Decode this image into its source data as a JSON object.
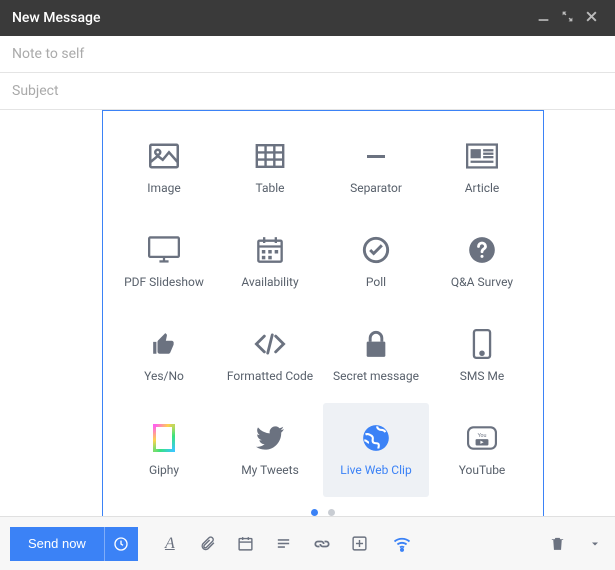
{
  "window": {
    "title": "New Message",
    "minimize_icon": "minimize",
    "expand_icon": "expand",
    "close_icon": "close"
  },
  "fields": {
    "to_placeholder": "Note to self",
    "subject_placeholder": "Subject"
  },
  "inserter": {
    "tiles": [
      {
        "label": "Image",
        "icon": "image"
      },
      {
        "label": "Table",
        "icon": "table"
      },
      {
        "label": "Separator",
        "icon": "separator"
      },
      {
        "label": "Article",
        "icon": "article"
      },
      {
        "label": "PDF Slideshow",
        "icon": "monitor"
      },
      {
        "label": "Availability",
        "icon": "calendar"
      },
      {
        "label": "Poll",
        "icon": "check-circle"
      },
      {
        "label": "Q&A Survey",
        "icon": "help-circle"
      },
      {
        "label": "Yes/No",
        "icon": "thumbs-up"
      },
      {
        "label": "Formatted Code",
        "icon": "code"
      },
      {
        "label": "Secret message",
        "icon": "lock"
      },
      {
        "label": "SMS Me",
        "icon": "phone"
      },
      {
        "label": "Giphy",
        "icon": "giphy"
      },
      {
        "label": "My Tweets",
        "icon": "twitter"
      },
      {
        "label": "Live Web Clip",
        "icon": "globe",
        "selected": true
      },
      {
        "label": "YouTube",
        "icon": "youtube"
      }
    ],
    "page_count": 2,
    "active_page": 0
  },
  "toolbar": {
    "send_label": "Send now"
  }
}
